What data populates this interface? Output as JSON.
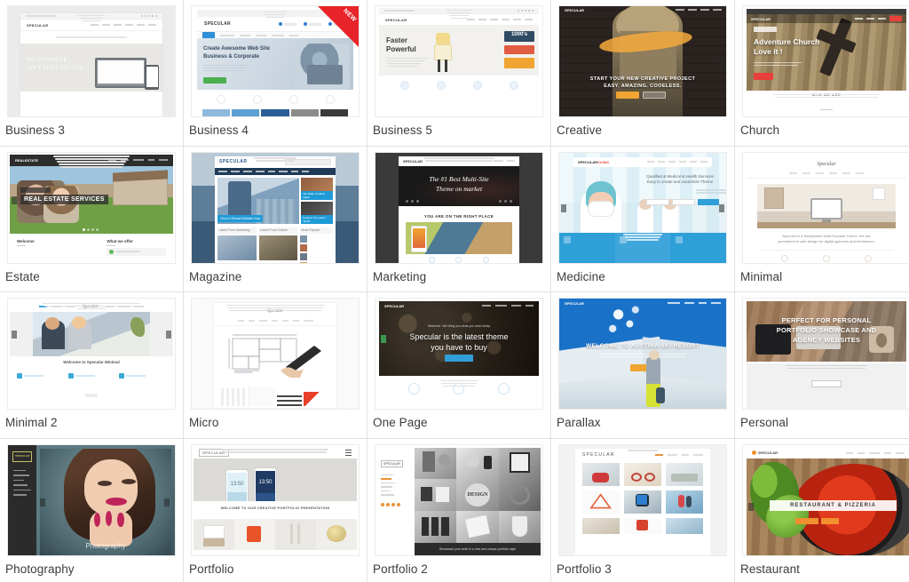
{
  "gallery": {
    "columns": 5,
    "rows": 4,
    "border_color": "#e2e2e2",
    "label_color": "#3c3c3c",
    "badge": {
      "text": "NEW",
      "color": "#e8242a"
    },
    "items": [
      {
        "label": "Business 3",
        "badge": null,
        "hero_text": [
          "RESPONSIVE",
          "ON EVERY DEVICE"
        ],
        "bg": "#e9e9e9"
      },
      {
        "label": "Business 4",
        "badge": "NEW",
        "hero_text": [
          "Create Awesome Web Site",
          "Business & Corporate"
        ],
        "bg": "#dfe4e8"
      },
      {
        "label": "Business 5",
        "badge": null,
        "hero_text": [
          "Faster",
          "Powerful",
          "1000's"
        ],
        "bg": "#f0f0ee"
      },
      {
        "label": "Creative",
        "badge": null,
        "hero_text": [
          "START YOUR NEW CREATIVE PROJECT",
          "EASY. AMAZING. COOELESS."
        ],
        "bg": "#2b2522"
      },
      {
        "label": "Church",
        "badge": null,
        "hero_text": [
          "Adventure Church",
          "Love it !",
          "WHO WE ARE"
        ],
        "bg": "#8a7a5e"
      },
      {
        "label": "Estate",
        "badge": null,
        "hero_text": [
          "REAL ESTATE SERVICES",
          "Welcome",
          "What we offer"
        ],
        "bg": "#6a9148"
      },
      {
        "label": "Magazine",
        "badge": null,
        "hero_text": [],
        "bg": "#4c6d8c"
      },
      {
        "label": "Marketing",
        "badge": null,
        "hero_text": [
          "The #1 Best Multi-Site",
          "Theme on market",
          "YOU ARE ON THE RIGHT PLACE"
        ],
        "bg": "#3b3b3b"
      },
      {
        "label": "Medicine",
        "badge": null,
        "hero_text": [
          "Qualified & Medical & Health Services",
          "Easy to create and customize Theme"
        ],
        "bg": "#cfe5ef"
      },
      {
        "label": "Minimal",
        "badge": null,
        "hero_text": [
          "Specular is a Responsive Multi-Purpose Theme. We are",
          "specialized in web design for digital agencies and freelancers."
        ],
        "bg": "#ffffff"
      },
      {
        "label": "Minimal 2",
        "badge": null,
        "hero_text": [
          "Welcome to Specular Minimal"
        ],
        "bg": "#ffffff"
      },
      {
        "label": "Micro",
        "badge": null,
        "hero_text": [],
        "bg": "#ffffff"
      },
      {
        "label": "One Page",
        "badge": null,
        "hero_text": [
          "Specular is the latest theme",
          "you have to buy"
        ],
        "bg": "#2a2118"
      },
      {
        "label": "Parallax",
        "badge": null,
        "hero_text": [
          "WELCOME TO AUSTRIA SKI RESORT"
        ],
        "bg": "#1b7ed6"
      },
      {
        "label": "Personal",
        "badge": null,
        "hero_text": [
          "PERFECT FOR PERSONAL",
          "PORTFOLIO SHOWCASE AND",
          "AGENCY WEBSITES"
        ],
        "bg": "#8b7b6d"
      },
      {
        "label": "Photography",
        "badge": null,
        "hero_text": [
          "Photography"
        ],
        "bg": "#60737a"
      },
      {
        "label": "Portfolio",
        "badge": null,
        "hero_text": [
          "WELCOME TO OUR CREATIVE PORTFOLIO PRESENTATION",
          "13:50"
        ],
        "bg": "#d9d7d4"
      },
      {
        "label": "Portfolio 2",
        "badge": null,
        "hero_text": [
          "DESIGN",
          "Showcase your work in a new and unique portfolio style"
        ],
        "bg": "#9b9b9b"
      },
      {
        "label": "Portfolio 3",
        "badge": null,
        "hero_text": [
          "SPECULAR"
        ],
        "bg": "#f4f4f4"
      },
      {
        "label": "Restaurant",
        "badge": null,
        "hero_text": [
          "RESTAURANT & PIZZERIA"
        ],
        "bg": "#a3341c"
      }
    ]
  }
}
